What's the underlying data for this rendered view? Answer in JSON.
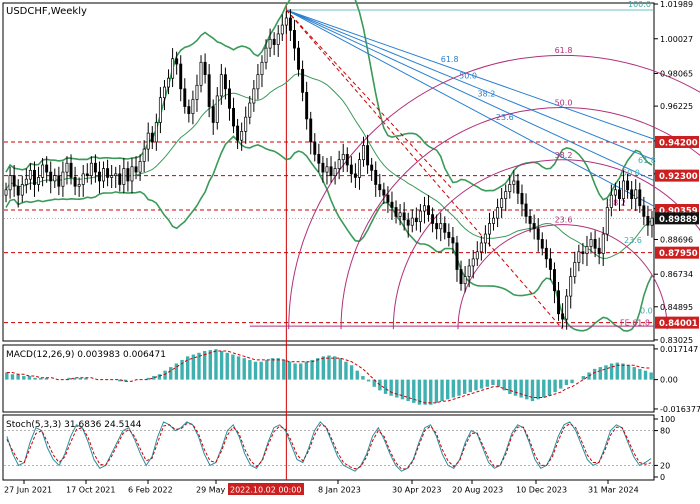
{
  "window_title": "USDCHF,Weekly",
  "colors": {
    "bull_candle": "#ffffff",
    "bear_candle": "#000000",
    "bollinger": "#3a9a58",
    "fib_level": "#cc0000",
    "fan": "#2a7fd0",
    "arcs": "#b0307a",
    "macd_hist": "#3fb0b0",
    "macd_signal": "#cc0000",
    "stoch_main": "#2a8fa0",
    "stoch_signal": "#cc0000",
    "price_label_bg": "#cc1f1f",
    "current_label_bg": "#111111"
  },
  "price_axis": {
    "ticks": [
      "1.01989",
      "1.00027",
      "0.98065",
      "0.96225",
      "0.94263",
      "0.92401",
      "0.90439",
      "0.88696",
      "0.86734",
      "0.84895",
      "0.83025"
    ],
    "labels": [
      {
        "text": "0.94200",
        "kind": "level"
      },
      {
        "text": "0.92300",
        "kind": "level"
      },
      {
        "text": "0.90359",
        "kind": "level"
      },
      {
        "text": "0.89889",
        "kind": "current"
      },
      {
        "text": "0.87950",
        "kind": "level"
      },
      {
        "text": "0.84001",
        "kind": "level"
      }
    ]
  },
  "time_axis": {
    "labels": [
      "27 Jun 2021",
      "17 Oct 2021",
      "6 Feb 2022",
      "29 May",
      "2022.10.02 00:00",
      "8 Jan 2023",
      "30 Apr 2023",
      "20 Aug 2023",
      "10 Dec 2023",
      "31 Mar 2024"
    ]
  },
  "fibo": {
    "retracement": [
      "100.0",
      "0.0",
      "FE 61.8"
    ],
    "fan": [
      "61.8",
      "50.0",
      "38.2",
      "23.6"
    ],
    "arcs": [
      "61.8",
      "50.0",
      "38.2",
      "23.6"
    ],
    "channel": [
      "61.8",
      "50.0",
      "38.2",
      "23.6"
    ]
  },
  "macd": {
    "title": "MACD(12,26,9) 0.003983 0.006471",
    "ticks": [
      "0.017147",
      "0.00",
      "-0.016377"
    ]
  },
  "stoch": {
    "title": "Stoch(5,3,3) 31.6836 24.5144",
    "ticks": [
      "100",
      "80",
      "20",
      "0"
    ]
  },
  "chart_data": [
    {
      "type": "candlestick",
      "title": "USDCHF,Weekly",
      "ylim": [
        0.8302,
        1.0199
      ],
      "series": [
        {
          "name": "USDCHF",
          "values": [
            0.915,
            0.923,
            0.917,
            0.912,
            0.918,
            0.921,
            0.926,
            0.918,
            0.922,
            0.929,
            0.925,
            0.92,
            0.923,
            0.917,
            0.925,
            0.93,
            0.922,
            0.917,
            0.918,
            0.924,
            0.923,
            0.93,
            0.925,
            0.92,
            0.927,
            0.922,
            0.923,
            0.924,
            0.918,
            0.927,
            0.92,
            0.928,
            0.925,
            0.931,
            0.938,
            0.947,
            0.942,
            0.953,
            0.967,
            0.973,
            0.978,
            0.989,
            0.986,
            0.972,
            0.962,
            0.958,
            0.966,
            0.974,
            0.987,
            0.98,
            0.962,
            0.953,
            0.968,
            0.98,
            0.972,
            0.961,
            0.951,
            0.943,
            0.948,
            0.956,
            0.964,
            0.972,
            0.98,
            0.987,
            0.995,
            1.0,
            0.997,
            1.003,
            1.008,
            1.012,
            1.005,
            0.995,
            0.983,
            0.97,
            0.955,
            0.942,
            0.935,
            0.93,
            0.925,
            0.928,
            0.923,
            0.927,
            0.932,
            0.935,
            0.929,
            0.924,
            0.922,
            0.932,
            0.94,
            0.929,
            0.926,
            0.918,
            0.915,
            0.912,
            0.908,
            0.905,
            0.9,
            0.902,
            0.898,
            0.895,
            0.899,
            0.897,
            0.903,
            0.906,
            0.901,
            0.896,
            0.893,
            0.896,
            0.891,
            0.888,
            0.885,
            0.87,
            0.862,
            0.866,
            0.872,
            0.876,
            0.88,
            0.885,
            0.89,
            0.896,
            0.899,
            0.905,
            0.91,
            0.914,
            0.918,
            0.92,
            0.913,
            0.907,
            0.9,
            0.896,
            0.893,
            0.887,
            0.882,
            0.876,
            0.87,
            0.858,
            0.845,
            0.842,
            0.855,
            0.866,
            0.874,
            0.88,
            0.879,
            0.883,
            0.887,
            0.882,
            0.879,
            0.89,
            0.905,
            0.912,
            0.915,
            0.91,
            0.92,
            0.915,
            0.91,
            0.915,
            0.906,
            0.9,
            0.895,
            0.899
          ]
        }
      ]
    },
    {
      "type": "bar",
      "title": "MACD(12,26,9) 0.003983 0.006471",
      "ylim": [
        -0.0164,
        0.0171
      ],
      "series": [
        {
          "name": "MACD",
          "values": [
            0.004,
            0.003,
            0.003,
            0.002,
            0.002,
            0.001,
            0.001,
            0.001,
            0.0,
            0.0,
            0.0,
            0.001,
            0.001,
            0.001,
            0.001,
            0.0,
            0.0,
            0.0,
            0.0,
            0.0,
            -0.001,
            -0.001,
            0.0,
            0.0,
            0.0,
            0.001,
            0.002,
            0.003,
            0.005,
            0.007,
            0.009,
            0.011,
            0.013,
            0.014,
            0.015,
            0.016,
            0.0165,
            0.017,
            0.016,
            0.015,
            0.014,
            0.013,
            0.012,
            0.011,
            0.01,
            0.01,
            0.011,
            0.012,
            0.012,
            0.011,
            0.01,
            0.009,
            0.009,
            0.01,
            0.011,
            0.012,
            0.013,
            0.0135,
            0.013,
            0.012,
            0.01,
            0.008,
            0.005,
            0.002,
            -0.001,
            -0.004,
            -0.006,
            -0.008,
            -0.009,
            -0.01,
            -0.011,
            -0.012,
            -0.013,
            -0.014,
            -0.014,
            -0.014,
            -0.013,
            -0.012,
            -0.011,
            -0.01,
            -0.009,
            -0.008,
            -0.007,
            -0.006,
            -0.005,
            -0.004,
            -0.003,
            -0.004,
            -0.006,
            -0.008,
            -0.009,
            -0.01,
            -0.011,
            -0.012,
            -0.011,
            -0.01,
            -0.009,
            -0.007,
            -0.005,
            -0.003,
            -0.002,
            0.0,
            0.002,
            0.004,
            0.006,
            0.007,
            0.008,
            0.009,
            0.0095,
            0.009,
            0.008,
            0.007,
            0.006,
            0.005,
            0.004
          ]
        },
        {
          "name": "Signal",
          "values": [
            0.004,
            0.004,
            0.003,
            0.003,
            0.002,
            0.002,
            0.001,
            0.001,
            0.001,
            0.0,
            0.0,
            0.0,
            0.001,
            0.001,
            0.001,
            0.001,
            0.0,
            0.0,
            0.0,
            0.0,
            0.0,
            -0.001,
            -0.001,
            0.0,
            0.0,
            0.0,
            0.001,
            0.002,
            0.003,
            0.005,
            0.007,
            0.009,
            0.011,
            0.012,
            0.013,
            0.014,
            0.015,
            0.016,
            0.016,
            0.016,
            0.015,
            0.014,
            0.013,
            0.012,
            0.011,
            0.011,
            0.011,
            0.011,
            0.011,
            0.011,
            0.01,
            0.01,
            0.01,
            0.01,
            0.01,
            0.011,
            0.012,
            0.012,
            0.012,
            0.012,
            0.011,
            0.01,
            0.008,
            0.006,
            0.003,
            0.0,
            -0.003,
            -0.005,
            -0.007,
            -0.008,
            -0.009,
            -0.01,
            -0.011,
            -0.012,
            -0.013,
            -0.013,
            -0.013,
            -0.012,
            -0.012,
            -0.011,
            -0.01,
            -0.009,
            -0.008,
            -0.007,
            -0.006,
            -0.005,
            -0.004,
            -0.004,
            -0.005,
            -0.006,
            -0.007,
            -0.008,
            -0.009,
            -0.01,
            -0.01,
            -0.01,
            -0.009,
            -0.008,
            -0.007,
            -0.005,
            -0.004,
            -0.002,
            0.0,
            0.002,
            0.004,
            0.005,
            0.006,
            0.007,
            0.008,
            0.008,
            0.008,
            0.008,
            0.007,
            0.0065,
            0.0065
          ]
        }
      ]
    },
    {
      "type": "line",
      "title": "Stoch(5,3,3) 31.6836 24.5144",
      "ylim": [
        0,
        100
      ],
      "series": [
        {
          "name": "Main",
          "values": [
            70,
            40,
            20,
            25,
            60,
            85,
            80,
            50,
            30,
            20,
            40,
            70,
            90,
            85,
            60,
            30,
            15,
            20,
            40,
            60,
            80,
            85,
            65,
            40,
            20,
            35,
            70,
            95,
            90,
            80,
            85,
            95,
            90,
            70,
            40,
            20,
            25,
            50,
            80,
            90,
            70,
            40,
            20,
            15,
            30,
            60,
            85,
            90,
            80,
            55,
            30,
            25,
            50,
            80,
            95,
            85,
            60,
            35,
            20,
            15,
            10,
            20,
            40,
            70,
            85,
            65,
            40,
            20,
            10,
            15,
            30,
            60,
            85,
            90,
            70,
            40,
            20,
            15,
            30,
            60,
            80,
            75,
            50,
            25,
            15,
            20,
            45,
            75,
            90,
            85,
            60,
            30,
            15,
            20,
            40,
            70,
            90,
            95,
            80,
            55,
            30,
            20,
            25,
            50,
            80,
            90,
            85,
            60,
            35,
            20,
            25,
            31.7
          ]
        },
        {
          "name": "Signal",
          "values": [
            65,
            45,
            28,
            25,
            50,
            75,
            80,
            60,
            38,
            25,
            35,
            60,
            82,
            85,
            68,
            40,
            22,
            20,
            35,
            55,
            75,
            82,
            70,
            48,
            28,
            32,
            60,
            88,
            90,
            82,
            83,
            92,
            91,
            75,
            48,
            28,
            25,
            45,
            72,
            86,
            75,
            48,
            28,
            18,
            28,
            55,
            78,
            88,
            82,
            62,
            38,
            28,
            45,
            72,
            90,
            87,
            65,
            42,
            25,
            18,
            14,
            18,
            35,
            62,
            80,
            70,
            45,
            25,
            14,
            14,
            28,
            55,
            80,
            88,
            75,
            48,
            28,
            18,
            28,
            55,
            75,
            76,
            55,
            32,
            18,
            20,
            40,
            70,
            86,
            86,
            65,
            38,
            20,
            20,
            35,
            62,
            85,
            92,
            85,
            62,
            38,
            25,
            25,
            45,
            72,
            86,
            85,
            65,
            42,
            25,
            22,
            24.5
          ]
        }
      ]
    }
  ]
}
